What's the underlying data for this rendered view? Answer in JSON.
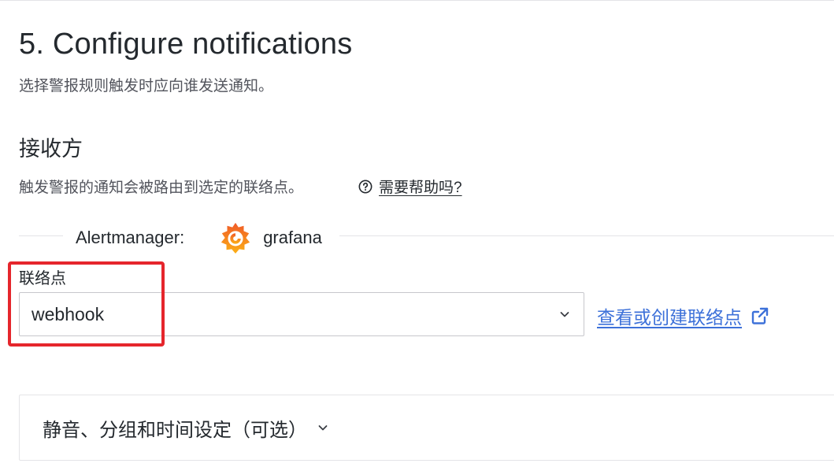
{
  "step": {
    "title": "5. Configure notifications",
    "description": "选择警报规则触发时应向谁发送通知。"
  },
  "receiver": {
    "title": "接收方",
    "description": "触发警报的通知会被路由到选定的联络点。",
    "help_link": "需要帮助吗?"
  },
  "alertmanager": {
    "label": "Alertmanager:",
    "name": "grafana",
    "icon": "grafana-logo"
  },
  "contact_point": {
    "label": "联络点",
    "selected_value": "webhook",
    "view_link": "查看或创建联络点"
  },
  "advanced": {
    "title": "静音、分组和时间设定（可选）"
  },
  "colors": {
    "link": "#3d71d9",
    "highlight": "#e5262c",
    "grafana_orange": "#f46800"
  }
}
